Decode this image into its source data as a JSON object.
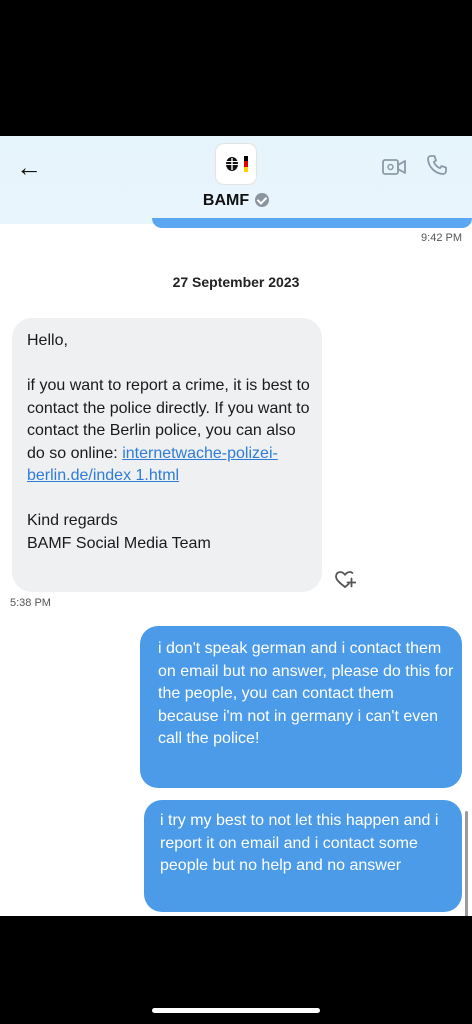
{
  "header": {
    "contact_name": "BAMF",
    "back_icon": "arrow-left-icon",
    "logo": "german-federal-eagle-logo",
    "verified_icon": "verified-badge-icon",
    "video_icon": "video-call-icon",
    "phone_icon": "phone-icon"
  },
  "thread": {
    "prev_time": "9:42 PM",
    "date_separator": "27 September 2023",
    "incoming": {
      "text_before_link": "Hello,\n\nif you want to report a crime, it is best to contact the police directly. If you want to contact the Berlin police, you can also do so online: ",
      "link": "internetwache-polizei-berlin.de/index 1.html",
      "text_after_link": "\n\nKind regards\nBAMF Social Media Team",
      "time": "5:38 PM",
      "reaction_icon": "add-reaction-heart-icon"
    },
    "outgoing": [
      {
        "text": "i don't speak german and i contact them on email but no answer, please do this for the people, you can contact them because i'm not in germany i can't even call the police!"
      },
      {
        "text": "i try my best to not let this happen and i report it on email and i contact some people but no help and no answer"
      }
    ]
  },
  "colors": {
    "header_bg": "#e6f4fb",
    "outgoing_bubble": "#4c9be8",
    "incoming_bubble": "#eef0f2",
    "link": "#2f7cd7"
  }
}
